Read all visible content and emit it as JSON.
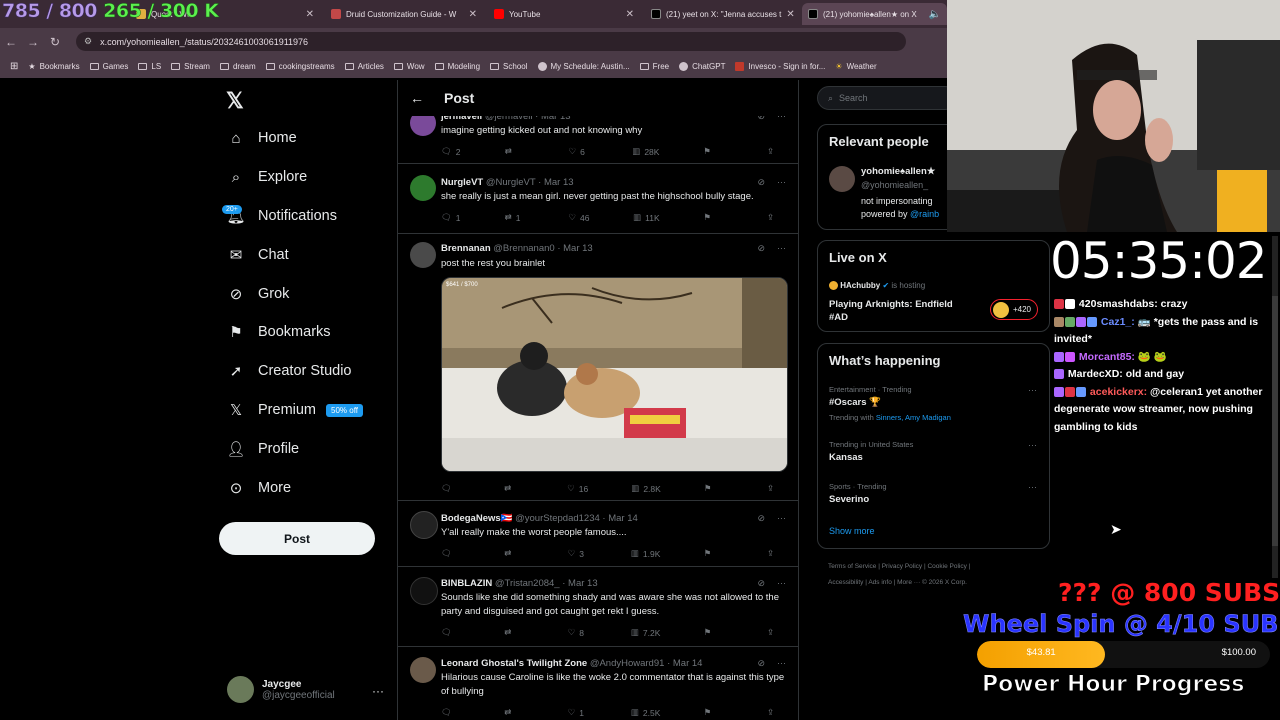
{
  "browser": {
    "tabs": [
      {
        "label": "Quest - Wo",
        "color": "#e0b040"
      },
      {
        "label": "Druid Customization Guide - W",
        "color": "#c24848"
      },
      {
        "label": "YouTube",
        "color": "#ff0000"
      },
      {
        "label": "(21) yeet on X: \"Jenna accuses t",
        "color": "#000000"
      },
      {
        "label": "(21) yohomie♠allen★ on X",
        "color": "#000000"
      }
    ],
    "url": "x.com/yohomieallen_/status/2032461003061911976",
    "bookmarks": [
      "Bookmarks",
      "Games",
      "LS",
      "Stream",
      "dream",
      "cookingstreams",
      "Articles",
      "Wow",
      "Modeling",
      "School",
      "My Schedule: Austin...",
      "Free",
      "ChatGPT",
      "Invesco - Sign in for...",
      "Weather"
    ]
  },
  "overlay_counter": {
    "a": "785 / 800",
    "b": "265 / 300 K"
  },
  "nav": {
    "home": "Home",
    "explore": "Explore",
    "notifications": "Notifications",
    "notif_badge": "20+",
    "chat": "Chat",
    "grok": "Grok",
    "bookmarks": "Bookmarks",
    "creator": "Creator Studio",
    "premium": "Premium",
    "premium_pill": "50% off",
    "profile": "Profile",
    "more": "More",
    "post_button": "Post"
  },
  "account": {
    "name": "Jaycgee",
    "handle": "@jaycgeeofficial"
  },
  "header": {
    "title": "Post"
  },
  "tweets": [
    {
      "name": "jermaveli",
      "handle": "@jermaveli",
      "date": "Mar 13",
      "text": "imagine getting kicked out and not knowing why",
      "replies": "2",
      "reposts": "",
      "likes": "6",
      "views": "28K"
    },
    {
      "name": "NurgleVT",
      "handle": "@NurgleVT",
      "date": "Mar 13",
      "text": "she really is just a mean girl. never getting past the highschool bully stage.",
      "replies": "1",
      "reposts": "1",
      "likes": "46",
      "views": "11K"
    },
    {
      "name": "Brennanan",
      "handle": "@Brennanan0",
      "date": "Mar 13",
      "text": "post the rest you brainlet",
      "replies": "",
      "reposts": "",
      "likes": "16",
      "views": "2.8K",
      "media_caption": "$641 / $700"
    },
    {
      "name": "BodegaNews🇵🇷",
      "handle": "@yourStepdad1234",
      "date": "Mar 14",
      "text": "Y'all really make the worst people famous....",
      "replies": "",
      "reposts": "",
      "likes": "3",
      "views": "1.9K"
    },
    {
      "name": "BINBLAZIN",
      "handle": "@Tristan2084_",
      "date": "Mar 13",
      "text": "Sounds like she did something shady and was aware she was not allowed to the party and disguised and got caught get rekt I guess.",
      "replies": "",
      "reposts": "",
      "likes": "8",
      "views": "7.2K"
    },
    {
      "name": "Leonard Ghostal's Twilight Zone",
      "handle": "@AndyHoward91",
      "date": "Mar 14",
      "text": "Hilarious cause Caroline is like the woke 2.0 commentator that is against this type of bullying",
      "replies": "",
      "reposts": "",
      "likes": "1",
      "views": "2.5K"
    }
  ],
  "right": {
    "search_placeholder": "Search",
    "relevant_title": "Relevant people",
    "relevant_name": "yohomie♠allen★",
    "relevant_handle": "@yohomieallen_",
    "relevant_bio1": "not impersonating",
    "relevant_bio2_prefix": "powered by ",
    "relevant_bio2_link": "@rainb",
    "live_title": "Live on X",
    "live_host": "HAchubby",
    "live_hosting": "is hosting",
    "live_game": "Playing Arknights: Endfield",
    "live_game2": "#AD",
    "live_count": "+420",
    "happening_title": "What’s happening",
    "trends": [
      {
        "cat": "Entertainment · Trending",
        "name": "#Oscars 🏆",
        "with_label": "Trending with ",
        "with": "Sinners, Amy Madigan"
      },
      {
        "cat": "Trending in United States",
        "name": "Kansas"
      },
      {
        "cat": "Sports · Trending",
        "name": "Severino"
      }
    ],
    "show_more": "Show more",
    "footer1": "Terms of Service  |  Privacy Policy  |  Cookie Policy  |",
    "footer2": "Accessibility  |  Ads info  |  More ···  © 2026 X Corp."
  },
  "stream": {
    "timer": "05:35:02",
    "chat": [
      {
        "user": "420smashdabs:",
        "msg": " crazy",
        "color": "u1"
      },
      {
        "user": "Caz1_:",
        "msg": " 🚌 *gets the pass and is invited*",
        "color": "u2"
      },
      {
        "user": "Morcant85:",
        "msg": " 🐸 🐸",
        "color": "u3"
      },
      {
        "user": "MardecXD:",
        "msg": " old and gay",
        "color": "u1"
      },
      {
        "user": "acekickerx:",
        "msg": " @celeran1 yet another degenerate wow streamer, now pushing gambling to kids",
        "color": "u4"
      }
    ],
    "goal1": "??? @ 800 SUBS",
    "goal2": "Wheel Spin @ 4/10 SUBS",
    "progress_current": "$43.81",
    "progress_total": "$100.00",
    "progress_fraction": 0.4381,
    "progress_label": "Power Hour Progress"
  }
}
